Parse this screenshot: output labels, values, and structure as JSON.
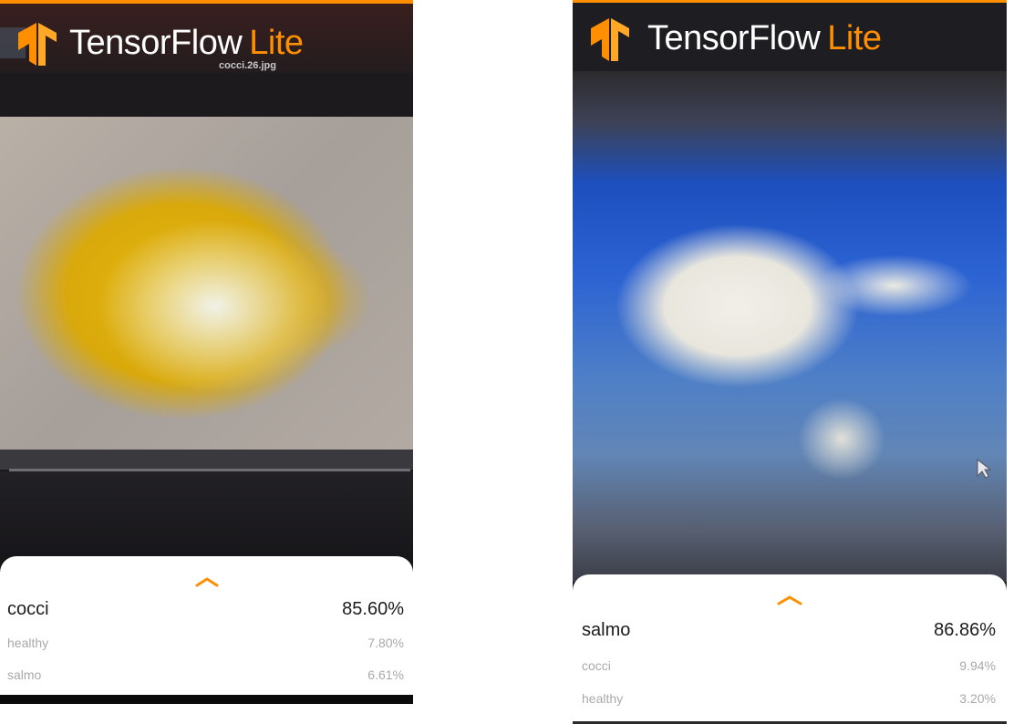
{
  "screens": [
    {
      "brand": {
        "name": "TensorFlow",
        "suffix": "Lite"
      },
      "filename_overlay": "cocci.26.jpg",
      "results": [
        {
          "label": "cocci",
          "value": "85.60%"
        },
        {
          "label": "healthy",
          "value": "7.80%"
        },
        {
          "label": "salmo",
          "value": "6.61%"
        }
      ]
    },
    {
      "brand": {
        "name": "TensorFlow",
        "suffix": "Lite"
      },
      "results": [
        {
          "label": "salmo",
          "value": "86.86%"
        },
        {
          "label": "cocci",
          "value": "9.94%"
        },
        {
          "label": "healthy",
          "value": "3.20%"
        }
      ]
    }
  ],
  "colors": {
    "accent": "#ff8f00",
    "top_result": "#1c1c1c",
    "sub_result": "#a9a9a9"
  },
  "icons": [
    "tensorflow-logo-icon",
    "chevron-up-icon",
    "mouse-cursor-icon"
  ]
}
